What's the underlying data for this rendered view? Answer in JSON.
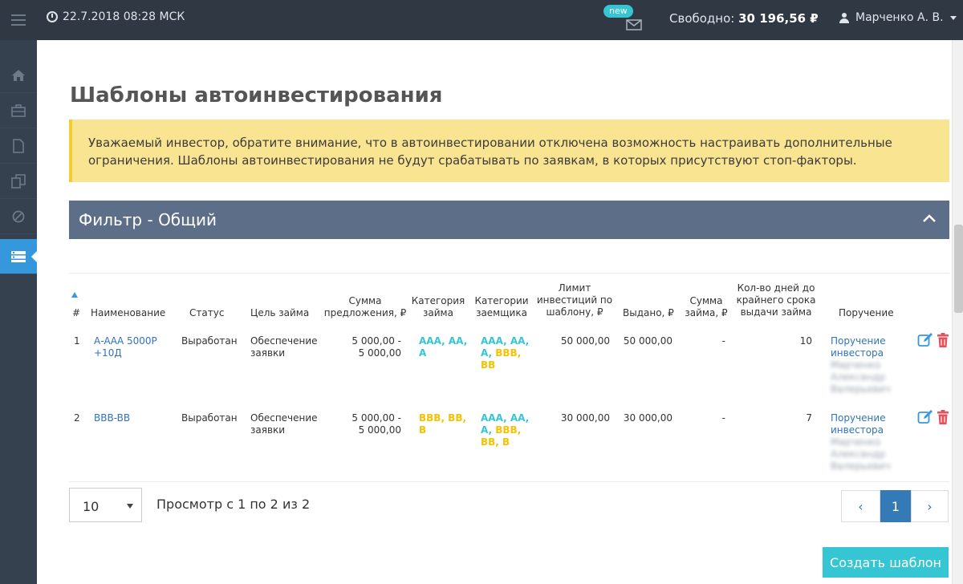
{
  "topbar": {
    "datetime": "22.7.2018 08:28 МСК",
    "mail_badge": "new",
    "balance_label": "Свободно:",
    "balance_value": "30 196,56 ₽",
    "user_name": "Марченко А. В."
  },
  "sidebar": {
    "items": [
      "home-icon",
      "briefcase-icon",
      "document-icon",
      "copy-icon",
      "ban-icon",
      "list-icon"
    ]
  },
  "page": {
    "title": "Шаблоны автоинвестирования",
    "alert_line1": "Уважаемый инвестор, обратите внимание, что в автоинвестировании отключена возможность настраивать дополнительные",
    "alert_line2": "ограничения. Шаблоны автоинвестирования не будут срабатывать по заявкам, в которых присутствуют стоп-факторы."
  },
  "filter": {
    "title": "Фильтр - Общий"
  },
  "table": {
    "headers": {
      "num": "#",
      "name": "Наименование",
      "status": "Статус",
      "goal": "Цель займа",
      "sum_offer_1": "Сумма",
      "sum_offer_2": "предложения, ₽",
      "loan_cat_1": "Категория",
      "loan_cat_2": "займа",
      "borrower_cat_1": "Категории",
      "borrower_cat_2": "заемщика",
      "limit_1": "Лимит",
      "limit_2": "инвестиций по",
      "limit_3": "шаблону, ₽",
      "issued": "Выдано, ₽",
      "loan_sum_1": "Сумма",
      "loan_sum_2": "займа, ₽",
      "days_1": "Кол-во дней до",
      "days_2": "крайнего срока",
      "days_3": "выдачи займа",
      "order": "Поручение"
    },
    "rows": [
      {
        "num": "1",
        "name_1": "А-ААА 5000Р",
        "name_2": "+10Д",
        "status": "Выработан",
        "goal_1": "Обеспечение",
        "goal_2": "заявки",
        "sum_1": "5 000,00 -",
        "sum_2": "5 000,00",
        "loan_cat_1": "AAA, AA,",
        "loan_cat_2": "A",
        "bc_1a": "AAA, AA,",
        "bc_2a": "A, ",
        "bc_2b": "BBB,",
        "bc_3b": "BB",
        "limit": "50 000,00",
        "issued": "50 000,00",
        "loan_sum": "-",
        "days": "10",
        "order_1": "Поручение",
        "order_2": "инвестора",
        "blur_1": "Марченко",
        "blur_2": "Александр",
        "blur_3": "Валерьевич"
      },
      {
        "num": "2",
        "name_1": "BBB-BB",
        "status": "Выработан",
        "goal_1": "Обеспечение",
        "goal_2": "заявки",
        "sum_1": "5 000,00 -",
        "sum_2": "5 000,00",
        "loan_cat_1": "BBB, BB,",
        "loan_cat_2": "B",
        "bc_1a": "AAA, AA,",
        "bc_2a": "A, ",
        "bc_2b": "BBB,",
        "bc_3b": "BB, B",
        "limit": "30 000,00",
        "issued": "30 000,00",
        "loan_sum": "-",
        "days": "7",
        "order_1": "Поручение",
        "order_2": "инвестора",
        "blur_1": "Марченко",
        "blur_2": "Александр",
        "blur_3": "Валерьевич"
      }
    ]
  },
  "footer": {
    "page_size": "10",
    "showing": "Просмотр с 1 по 2 из 2",
    "prev": "‹",
    "current_page": "1",
    "next": "›",
    "create_button": "Создать шаблон"
  },
  "colors": {
    "topbar": "#2f3843",
    "sidebar": "#364150",
    "accent": "#3598dc",
    "alert_bg": "#f9e491",
    "filter_bar": "#5c6e88",
    "teal": "#36c6d3",
    "yellow": "#f3c200",
    "delete_red": "#e7505a"
  }
}
